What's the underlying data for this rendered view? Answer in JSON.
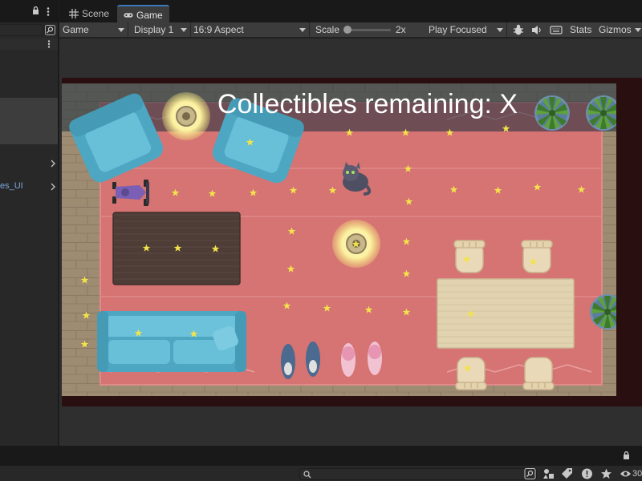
{
  "tabs": [
    {
      "label": "Scene",
      "icon": "scene-grid-icon",
      "active": false
    },
    {
      "label": "Game",
      "icon": "gamepad-icon",
      "active": true
    }
  ],
  "hierarchy": {
    "item_label": "es_UI"
  },
  "toolbar": {
    "view_mode": "Game",
    "display": "Display 1",
    "aspect": "16:9 Aspect",
    "scale_label": "Scale",
    "scale_value": "2x",
    "play_mode": "Play Focused",
    "stats": "Stats",
    "gizmos": "Gizmos"
  },
  "game": {
    "hud_text": "Collectibles remaining: X"
  },
  "bottom": {
    "count": "30"
  },
  "colors": {
    "rug": "#d67373",
    "floor": "#a08e74",
    "sofa": "#5fb6cf",
    "table_dark": "#4e3c37",
    "table_light": "#e6d7b4",
    "star": "#f2e34b",
    "hud_band": "rgba(20,40,55,0.55)",
    "tab_accent": "#3a79bb"
  }
}
